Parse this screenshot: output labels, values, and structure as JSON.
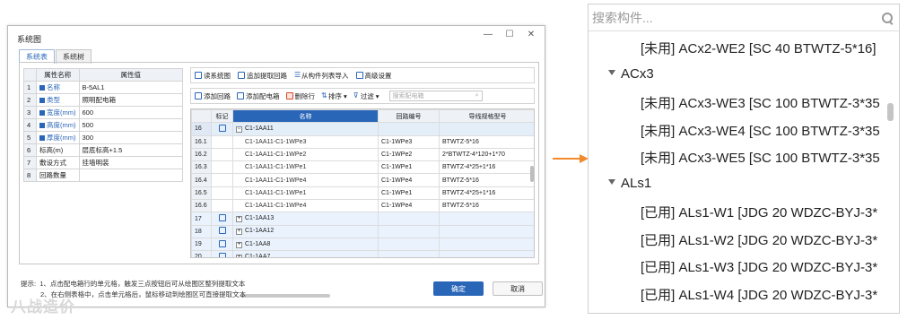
{
  "dialog": {
    "title": "系统图",
    "controls": {
      "minimize": "—",
      "maximize": "☐",
      "close": "✕"
    },
    "tabs": [
      "系统表",
      "系统树"
    ],
    "attr_table": {
      "headers": [
        "属性名称",
        "属性值"
      ],
      "rows": [
        {
          "n": "1",
          "k": "名称",
          "v": "B-5AL1",
          "blue": true
        },
        {
          "n": "2",
          "k": "类型",
          "v": "照明配电箱",
          "blue": true
        },
        {
          "n": "3",
          "k": "宽度(mm)",
          "v": "600",
          "blue": true
        },
        {
          "n": "4",
          "k": "高度(mm)",
          "v": "500",
          "blue": true
        },
        {
          "n": "5",
          "k": "厚度(mm)",
          "v": "300",
          "blue": true
        },
        {
          "n": "6",
          "k": "标高(m)",
          "v": "层底标高+1.5",
          "blue": false
        },
        {
          "n": "7",
          "k": "敷设方式",
          "v": "挂墙明装",
          "blue": false
        },
        {
          "n": "8",
          "k": "回路数量",
          "v": "",
          "blue": false
        }
      ]
    },
    "toolbar1": [
      "读系统图",
      "追加提取回路",
      "从构件列表导入",
      "高级设置"
    ],
    "toolbar2": {
      "add_circuit": "添加回路",
      "add_box": "添加配电箱",
      "delete_row": "删除行",
      "sort": "排序",
      "filter": "过滤",
      "search_placeholder": "搜索配电箱"
    },
    "grid": {
      "headers": [
        "",
        "标记",
        "名称",
        "回路编号",
        "导线规格型号"
      ],
      "rows": [
        {
          "rn": "16",
          "flag": true,
          "expand": "−",
          "name": "C1-1AA11",
          "code": "",
          "spec": "",
          "type": "parent"
        },
        {
          "rn": "16.1",
          "flag": false,
          "expand": "",
          "name": "C1-1AA11-C1-1WPe3",
          "code": "C1-1WPe3",
          "spec": "BTWTZ-5*16",
          "type": "child"
        },
        {
          "rn": "16.2",
          "flag": false,
          "expand": "",
          "name": "C1-1AA11-C1-1WPe2",
          "code": "C1-1WPe2",
          "spec": "2*BTWTZ-4*120+1*70",
          "type": "child"
        },
        {
          "rn": "16.3",
          "flag": false,
          "expand": "",
          "name": "C1-1AA11-C1-1WPe1",
          "code": "C1-1WPe1",
          "spec": "BTWTZ-4*25+1*16",
          "type": "child"
        },
        {
          "rn": "16.4",
          "flag": false,
          "expand": "",
          "name": "C1-1AA11-C1-1WPe4",
          "code": "C1-1WPe4",
          "spec": "BTWTZ-5*16",
          "type": "child"
        },
        {
          "rn": "16.5",
          "flag": false,
          "expand": "",
          "name": "C1-1AA11-C1-1WPe1",
          "code": "C1-1WPe1",
          "spec": "BTWTZ-4*25+1*16",
          "type": "child"
        },
        {
          "rn": "16.6",
          "flag": false,
          "expand": "",
          "name": "C1-1AA11-C1-1WPe4",
          "code": "C1-1WPe4",
          "spec": "BTWTZ-5*16",
          "type": "child"
        },
        {
          "rn": "17",
          "flag": true,
          "expand": "+",
          "name": "C1-1AA13",
          "code": "",
          "spec": "",
          "type": "hl"
        },
        {
          "rn": "18",
          "flag": true,
          "expand": "+",
          "name": "C1-1AA12",
          "code": "",
          "spec": "",
          "type": "hl"
        },
        {
          "rn": "19",
          "flag": true,
          "expand": "+",
          "name": "C1-1AA8",
          "code": "",
          "spec": "",
          "type": "hl"
        },
        {
          "rn": "20",
          "flag": true,
          "expand": "+",
          "name": "C1-1AA7",
          "code": "",
          "spec": "",
          "type": "hl"
        }
      ]
    },
    "tips": {
      "prefix": "提示:",
      "line1": "1、点击配电箱行的单元格，触发三点按钮后可从绘图区整列提取文本",
      "line2": "2、在右侧表格中，点击单元格后，鼠标移动到绘图区可直接提取文本"
    },
    "ok": "确定",
    "cancel": "取消"
  },
  "watermark": "八战造价",
  "panel": {
    "search_placeholder": "搜索构件...",
    "items": [
      {
        "kind": "leaf",
        "text": "[未用] ACx2-WE2 [SC 40 BTWTZ-5*16]"
      },
      {
        "kind": "group",
        "text": "ACx3"
      },
      {
        "kind": "leaf",
        "text": "[未用] ACx3-WE3 [SC 100 BTWTZ-3*35"
      },
      {
        "kind": "leaf",
        "text": "[未用] ACx3-WE4 [SC 100 BTWTZ-3*35"
      },
      {
        "kind": "leaf",
        "text": "[未用] ACx3-WE5 [SC 100 BTWTZ-3*35"
      },
      {
        "kind": "group",
        "text": "ALs1"
      },
      {
        "kind": "leaf",
        "text": "[已用] ALs1-W1 [JDG 20 WDZC-BYJ-3*"
      },
      {
        "kind": "leaf",
        "text": "[已用] ALs1-W2 [JDG 20 WDZC-BYJ-3*"
      },
      {
        "kind": "leaf",
        "text": "[已用] ALs1-W3 [JDG 20 WDZC-BYJ-3*"
      },
      {
        "kind": "leaf",
        "text": "[已用] ALs1-W4 [JDG 20 WDZC-BYJ-3*"
      }
    ]
  },
  "colors": {
    "accent": "#2a66b8",
    "arrow": "#f08a2c"
  }
}
